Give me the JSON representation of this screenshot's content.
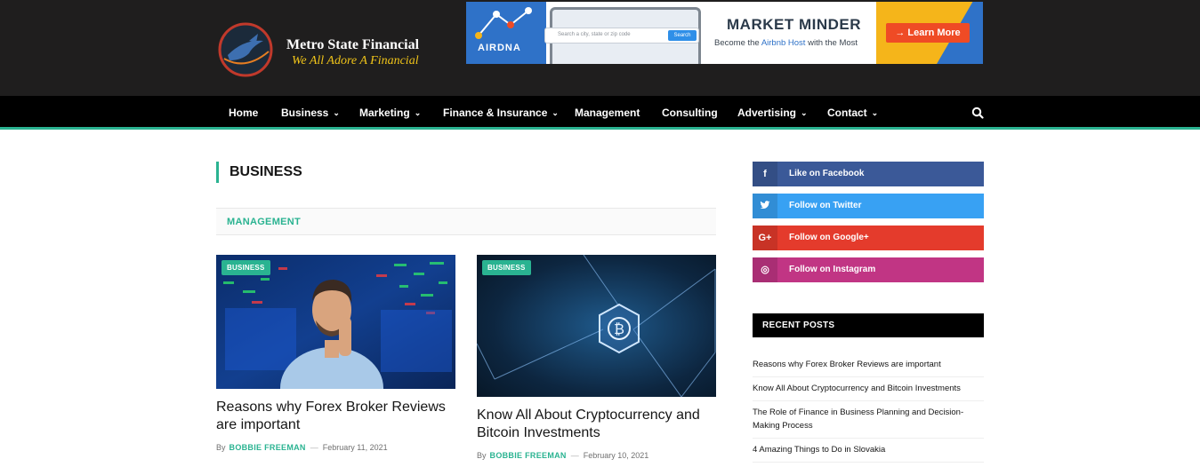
{
  "site": {
    "name": "Metro State Financial",
    "tagline": "We All Adore A Financial"
  },
  "ad": {
    "brand": "AIRDNA",
    "search_placeholder": "Search a city, state or zip code",
    "search_button": "Search",
    "title": "MARKET MINDER",
    "subtitle_pre": "Become the ",
    "subtitle_highlight": "Airbnb Host",
    "subtitle_post": " with the Most",
    "cta": "Learn More",
    "cta_arrow": "→"
  },
  "nav": {
    "items": [
      {
        "label": "Home",
        "dropdown": false
      },
      {
        "label": "Business",
        "dropdown": true
      },
      {
        "label": "Marketing",
        "dropdown": true
      },
      {
        "label": "Finance & Insurance",
        "dropdown": true
      },
      {
        "label": "Management",
        "dropdown": false
      },
      {
        "label": "Consulting",
        "dropdown": false
      },
      {
        "label": "Advertising",
        "dropdown": true
      },
      {
        "label": "Contact",
        "dropdown": true
      }
    ],
    "caret": "⌄",
    "search_icon": "search-icon"
  },
  "main": {
    "heading": "BUSINESS",
    "subcategory": "MANAGEMENT",
    "posts": [
      {
        "badge": "BUSINESS",
        "title": "Reasons why Forex Broker Reviews are important",
        "by": "By",
        "author": "BOBBIE FREEMAN",
        "date_sep": "—",
        "date": "February 11, 2021"
      },
      {
        "badge": "BUSINESS",
        "title": "Know All About Cryptocurrency and Bitcoin Investments",
        "by": "By",
        "author": "BOBBIE FREEMAN",
        "date_sep": "—",
        "date": "February 10, 2021"
      }
    ]
  },
  "sidebar": {
    "social": [
      {
        "label": "Like on Facebook",
        "icon": "facebook-icon",
        "glyph": "f",
        "color": "#3b5998"
      },
      {
        "label": "Follow on Twitter",
        "icon": "twitter-icon",
        "glyph": "🐦",
        "color": "#38a1f3"
      },
      {
        "label": "Follow on Google+",
        "icon": "google-plus-icon",
        "glyph": "G+",
        "color": "#e43b2c"
      },
      {
        "label": "Follow on Instagram",
        "icon": "instagram-icon",
        "glyph": "◎",
        "color": "#c13584"
      }
    ],
    "recent_heading": "RECENT POSTS",
    "recent_posts": [
      "Reasons why Forex Broker Reviews are important",
      "Know All About Cryptocurrency and Bitcoin Investments",
      "The Role of Finance in Business Planning and Decision-Making Process",
      "4 Amazing Things to Do in Slovakia"
    ]
  }
}
